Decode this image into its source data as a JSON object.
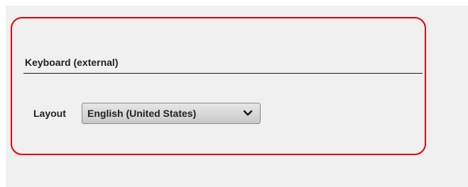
{
  "keyboard_section": {
    "title": "Keyboard (external)",
    "layout_label": "Layout",
    "layout_value": "English (United States)",
    "chevron_icon": "chevron-down-icon"
  },
  "colors": {
    "highlight_border": "#e60000",
    "panel_background": "#f0f0f0"
  }
}
